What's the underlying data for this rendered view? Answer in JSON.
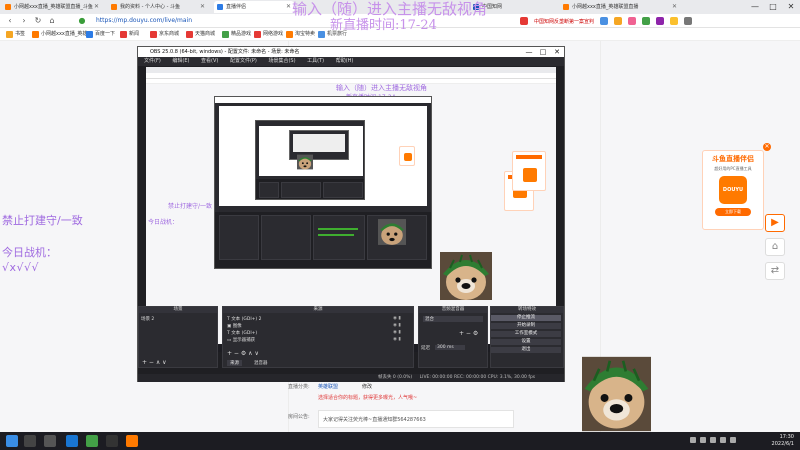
{
  "browser": {
    "tabs": [
      {
        "label": "小网越xxx直播_英雄联盟直播_斗鱼"
      },
      {
        "label": "我的资料 - 个人中心 - 斗鱼"
      },
      {
        "label": "直播伴侣"
      },
      {
        "label": "中国知网"
      },
      {
        "label": "小网越xxx直播_英雄联盟直播"
      }
    ],
    "url": "https://mp.douyu.com/live/main",
    "news_ticker": "中国知网反垄断第一案宣判",
    "bookmarks": [
      {
        "label": "书签"
      },
      {
        "label": "小网越xxx直播_英雄"
      },
      {
        "label": "百度一下"
      },
      {
        "label": "新闻"
      },
      {
        "label": "京东商城"
      },
      {
        "label": "天猫商城"
      },
      {
        "label": "精品游戏"
      },
      {
        "label": "网络游戏"
      },
      {
        "label": "淘宝特卖"
      },
      {
        "label": "机票旅行"
      }
    ],
    "win_ctrl": [
      "—",
      "□",
      "✕"
    ]
  },
  "overlay": {
    "line1": "输入（随）进入主播无敌视角",
    "line2": "新直播时间:17-24"
  },
  "left_messages": {
    "msg1": "禁止打建守/一致",
    "msg2": "今日战机：",
    "msg3": "√x√√√"
  },
  "obs": {
    "title": "OBS 25.0.8 (64-bit, windows) - 配置文件: 未命名 - 场景: 未命名",
    "menu": [
      "文件(F)",
      "编辑(E)",
      "查看(V)",
      "配置文件(P)",
      "场景集合(S)",
      "工具(T)",
      "帮助(H)"
    ],
    "docks": {
      "scenes": {
        "header": "场景",
        "items": [
          "场景 2"
        ]
      },
      "sources": {
        "header": "来源",
        "items": [
          "文本 (GDI+) 2",
          "图像",
          "文本 (GDI+)",
          "显示器捕获"
        ]
      },
      "mixer": {
        "header": "音频混音器",
        "item": "混合",
        "delay": "延迟",
        "delay_val": "300 ms"
      },
      "transitions": {
        "header": "转场特效"
      },
      "controls": {
        "header": "控件",
        "buttons": [
          "停止推流",
          "开始录制",
          "工作室模式",
          "设置",
          "退出"
        ]
      }
    },
    "tabs": [
      "来源",
      "混音器"
    ],
    "status": "LIVE: 00:00:00   REC: 00:00:00   CPU: 3.1%, 30.00 fps",
    "status_drop": "帧丢失 0 (0.0%)"
  },
  "douyu_card": {
    "title": "斗鱼直播伴侣",
    "subtitle": "超好用的PC直播工具",
    "logo_text": "DOUYU",
    "button": "立即下载",
    "close": "✕"
  },
  "page": {
    "category_label": "直播分类:",
    "category_value": "英雄联盟",
    "category_opt": "修改",
    "hint": "选择适合你的标题，获得更多曝光，人气哦~",
    "notice_label": "房间公告:",
    "notice": "大家记得关注荧光棒~直播通知群564287663"
  },
  "taskbar": {
    "time": "17:30",
    "date": "2022/6/1"
  },
  "colors": {
    "overlay": "#c792ea",
    "douyu_orange": "#ff6a00",
    "obs_bg": "#1f1f23"
  }
}
